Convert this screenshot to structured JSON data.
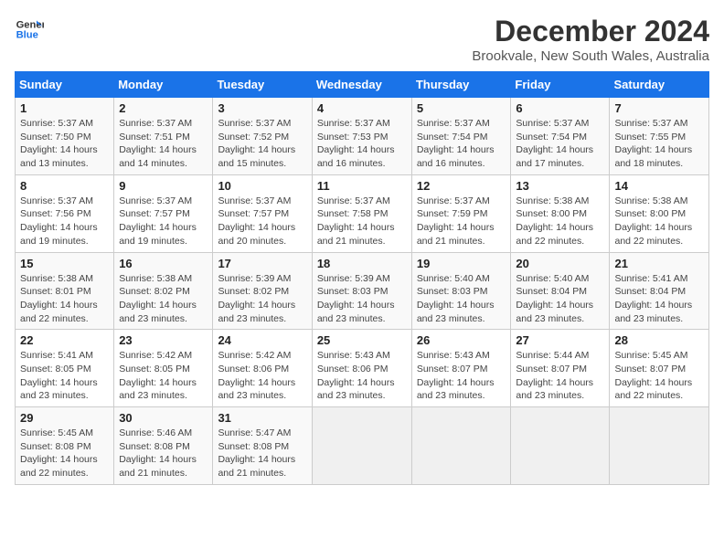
{
  "logo": {
    "line1": "General",
    "line2": "Blue"
  },
  "title": "December 2024",
  "subtitle": "Brookvale, New South Wales, Australia",
  "weekdays": [
    "Sunday",
    "Monday",
    "Tuesday",
    "Wednesday",
    "Thursday",
    "Friday",
    "Saturday"
  ],
  "weeks": [
    [
      {
        "day": "1",
        "sunrise": "5:37 AM",
        "sunset": "7:50 PM",
        "daylight": "14 hours and 13 minutes."
      },
      {
        "day": "2",
        "sunrise": "5:37 AM",
        "sunset": "7:51 PM",
        "daylight": "14 hours and 14 minutes."
      },
      {
        "day": "3",
        "sunrise": "5:37 AM",
        "sunset": "7:52 PM",
        "daylight": "14 hours and 15 minutes."
      },
      {
        "day": "4",
        "sunrise": "5:37 AM",
        "sunset": "7:53 PM",
        "daylight": "14 hours and 16 minutes."
      },
      {
        "day": "5",
        "sunrise": "5:37 AM",
        "sunset": "7:54 PM",
        "daylight": "14 hours and 16 minutes."
      },
      {
        "day": "6",
        "sunrise": "5:37 AM",
        "sunset": "7:54 PM",
        "daylight": "14 hours and 17 minutes."
      },
      {
        "day": "7",
        "sunrise": "5:37 AM",
        "sunset": "7:55 PM",
        "daylight": "14 hours and 18 minutes."
      }
    ],
    [
      {
        "day": "8",
        "sunrise": "5:37 AM",
        "sunset": "7:56 PM",
        "daylight": "14 hours and 19 minutes."
      },
      {
        "day": "9",
        "sunrise": "5:37 AM",
        "sunset": "7:57 PM",
        "daylight": "14 hours and 19 minutes."
      },
      {
        "day": "10",
        "sunrise": "5:37 AM",
        "sunset": "7:57 PM",
        "daylight": "14 hours and 20 minutes."
      },
      {
        "day": "11",
        "sunrise": "5:37 AM",
        "sunset": "7:58 PM",
        "daylight": "14 hours and 21 minutes."
      },
      {
        "day": "12",
        "sunrise": "5:37 AM",
        "sunset": "7:59 PM",
        "daylight": "14 hours and 21 minutes."
      },
      {
        "day": "13",
        "sunrise": "5:38 AM",
        "sunset": "8:00 PM",
        "daylight": "14 hours and 22 minutes."
      },
      {
        "day": "14",
        "sunrise": "5:38 AM",
        "sunset": "8:00 PM",
        "daylight": "14 hours and 22 minutes."
      }
    ],
    [
      {
        "day": "15",
        "sunrise": "5:38 AM",
        "sunset": "8:01 PM",
        "daylight": "14 hours and 22 minutes."
      },
      {
        "day": "16",
        "sunrise": "5:38 AM",
        "sunset": "8:02 PM",
        "daylight": "14 hours and 23 minutes."
      },
      {
        "day": "17",
        "sunrise": "5:39 AM",
        "sunset": "8:02 PM",
        "daylight": "14 hours and 23 minutes."
      },
      {
        "day": "18",
        "sunrise": "5:39 AM",
        "sunset": "8:03 PM",
        "daylight": "14 hours and 23 minutes."
      },
      {
        "day": "19",
        "sunrise": "5:40 AM",
        "sunset": "8:03 PM",
        "daylight": "14 hours and 23 minutes."
      },
      {
        "day": "20",
        "sunrise": "5:40 AM",
        "sunset": "8:04 PM",
        "daylight": "14 hours and 23 minutes."
      },
      {
        "day": "21",
        "sunrise": "5:41 AM",
        "sunset": "8:04 PM",
        "daylight": "14 hours and 23 minutes."
      }
    ],
    [
      {
        "day": "22",
        "sunrise": "5:41 AM",
        "sunset": "8:05 PM",
        "daylight": "14 hours and 23 minutes."
      },
      {
        "day": "23",
        "sunrise": "5:42 AM",
        "sunset": "8:05 PM",
        "daylight": "14 hours and 23 minutes."
      },
      {
        "day": "24",
        "sunrise": "5:42 AM",
        "sunset": "8:06 PM",
        "daylight": "14 hours and 23 minutes."
      },
      {
        "day": "25",
        "sunrise": "5:43 AM",
        "sunset": "8:06 PM",
        "daylight": "14 hours and 23 minutes."
      },
      {
        "day": "26",
        "sunrise": "5:43 AM",
        "sunset": "8:07 PM",
        "daylight": "14 hours and 23 minutes."
      },
      {
        "day": "27",
        "sunrise": "5:44 AM",
        "sunset": "8:07 PM",
        "daylight": "14 hours and 23 minutes."
      },
      {
        "day": "28",
        "sunrise": "5:45 AM",
        "sunset": "8:07 PM",
        "daylight": "14 hours and 22 minutes."
      }
    ],
    [
      {
        "day": "29",
        "sunrise": "5:45 AM",
        "sunset": "8:08 PM",
        "daylight": "14 hours and 22 minutes."
      },
      {
        "day": "30",
        "sunrise": "5:46 AM",
        "sunset": "8:08 PM",
        "daylight": "14 hours and 21 minutes."
      },
      {
        "day": "31",
        "sunrise": "5:47 AM",
        "sunset": "8:08 PM",
        "daylight": "14 hours and 21 minutes."
      },
      null,
      null,
      null,
      null
    ]
  ],
  "labels": {
    "sunrise": "Sunrise:",
    "sunset": "Sunset:",
    "daylight": "Daylight:"
  }
}
